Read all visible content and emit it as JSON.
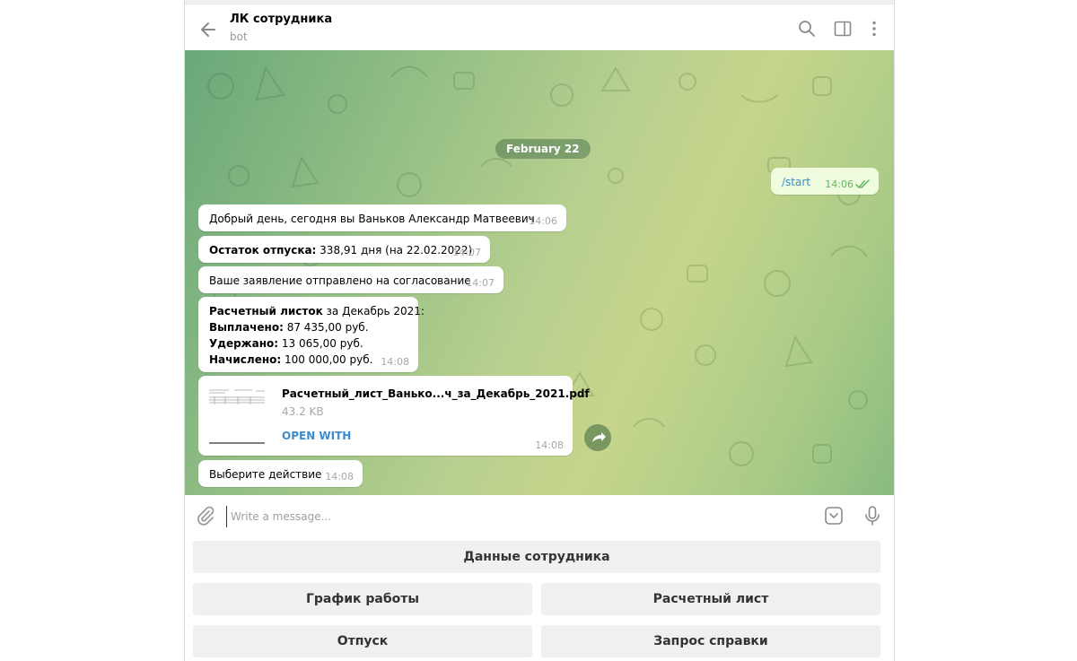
{
  "header": {
    "title": "ЛК сотрудника",
    "subtitle": "bot"
  },
  "chat": {
    "date": "February 22",
    "outgoing": {
      "text": "/start",
      "time": "14:06"
    },
    "messages": [
      {
        "text": "Добрый день, сегодня вы Ваньков Александр Матвеевич",
        "time": "14:06"
      },
      {
        "bold": "Остаток отпуска:",
        "text": " 338,91 дня (на 22.02.2022)",
        "time": "14:07"
      },
      {
        "text": "Ваше заявление отправлено на согласование",
        "time": "14:07"
      }
    ],
    "payslip": {
      "line1_bold": "Расчетный листок",
      "line1_rest": " за Декабрь 2021:",
      "line2_bold": "Выплачено:",
      "line2_rest": " 87 435,00 руб.",
      "line3_bold": "Удержано:",
      "line3_rest": " 13 065,00 руб.",
      "line4_bold": "Начислено:",
      "line4_rest": " 100 000,00 руб.",
      "time": "14:08"
    },
    "file": {
      "name": "Расчетный_лист_Ванько...ч_за_Декабрь_2021.pdf",
      "size": "43.2 KB",
      "action": "OPEN WITH",
      "time": "14:08"
    },
    "last": {
      "text": "Выберите действие",
      "time": "14:08"
    }
  },
  "composer": {
    "placeholder": "Write a message..."
  },
  "keyboard": {
    "employee_data": "Данные сотрудника",
    "schedule": "График работы",
    "payslip": "Расчетный лист",
    "vacation": "Отпуск",
    "certificate": "Запрос справки"
  },
  "colors": {
    "accent": "#3a8bd0",
    "outgoing_bubble": "#effdde",
    "keyboard_button": "#f0f0f0"
  },
  "icons": [
    "back-arrow-icon",
    "search-icon",
    "side-panel-icon",
    "more-vertical-icon",
    "share-icon",
    "paperclip-icon",
    "sticker-icon",
    "microphone-icon",
    "double-check-icon"
  ]
}
